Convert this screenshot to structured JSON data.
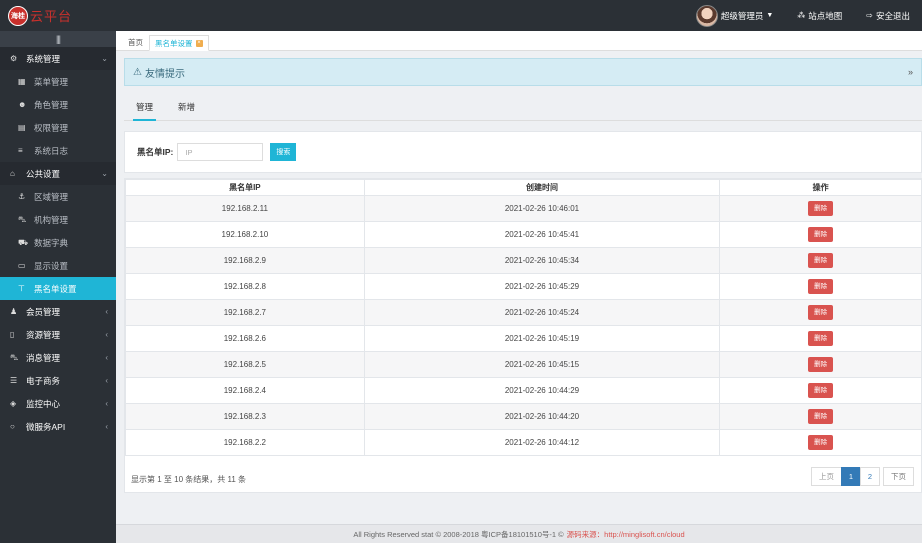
{
  "header": {
    "logo_badge": "海桂",
    "logo_text": "云平台",
    "user_name": "超级管理员",
    "sitemap_label": "站点地图",
    "logout_label": "安全退出"
  },
  "sidebar": {
    "groups": [
      {
        "label": "系统管理",
        "icon": "gears-icon",
        "children": [
          "菜单管理",
          "角色管理",
          "权限管理",
          "系统日志"
        ]
      },
      {
        "label": "公共设置",
        "icon": "bank-icon",
        "children": [
          "区域管理",
          "机构管理",
          "数据字典",
          "显示设置",
          "黑名单设置"
        ]
      },
      {
        "label": "会员管理"
      },
      {
        "label": "资源管理"
      },
      {
        "label": "消息管理"
      },
      {
        "label": "电子商务"
      },
      {
        "label": "监控中心"
      },
      {
        "label": "微服务API"
      }
    ],
    "active_item": "黑名单设置"
  },
  "tabs": {
    "home": "首页",
    "current": "黑名单设置"
  },
  "tips": {
    "title": "友情提示"
  },
  "subtabs": {
    "manage": "管理",
    "add": "新增"
  },
  "search": {
    "label": "黑名单IP:",
    "placeholder": "IP",
    "button": "搜索"
  },
  "table": {
    "headers": [
      "黑名单IP",
      "创建时间",
      "操作"
    ],
    "delete_label": "删除",
    "rows": [
      {
        "ip": "192.168.2.11",
        "time": "2021-02-26 10:46:01"
      },
      {
        "ip": "192.168.2.10",
        "time": "2021-02-26 10:45:41"
      },
      {
        "ip": "192.168.2.9",
        "time": "2021-02-26 10:45:34"
      },
      {
        "ip": "192.168.2.8",
        "time": "2021-02-26 10:45:29"
      },
      {
        "ip": "192.168.2.7",
        "time": "2021-02-26 10:45:24"
      },
      {
        "ip": "192.168.2.6",
        "time": "2021-02-26 10:45:19"
      },
      {
        "ip": "192.168.2.5",
        "time": "2021-02-26 10:45:15"
      },
      {
        "ip": "192.168.2.4",
        "time": "2021-02-26 10:44:29"
      },
      {
        "ip": "192.168.2.3",
        "time": "2021-02-26 10:44:20"
      },
      {
        "ip": "192.168.2.2",
        "time": "2021-02-26 10:44:12"
      }
    ]
  },
  "pagination": {
    "summary": "显示第 1 至 10 条结果，共 11 条",
    "prev": "上页",
    "pages": [
      "1",
      "2"
    ],
    "current": "1",
    "next": "下页"
  },
  "footer": {
    "text": "All Rights Reserved stat © 2008-2018 粤ICP备18101510号-1 ©",
    "source": "源码来源：http://minglisoft.cn/cloud"
  },
  "colors": {
    "accent": "#1fb5d6",
    "danger": "#d9534f",
    "sidebar_bg": "#2b3036",
    "primary": "#337ab7"
  }
}
